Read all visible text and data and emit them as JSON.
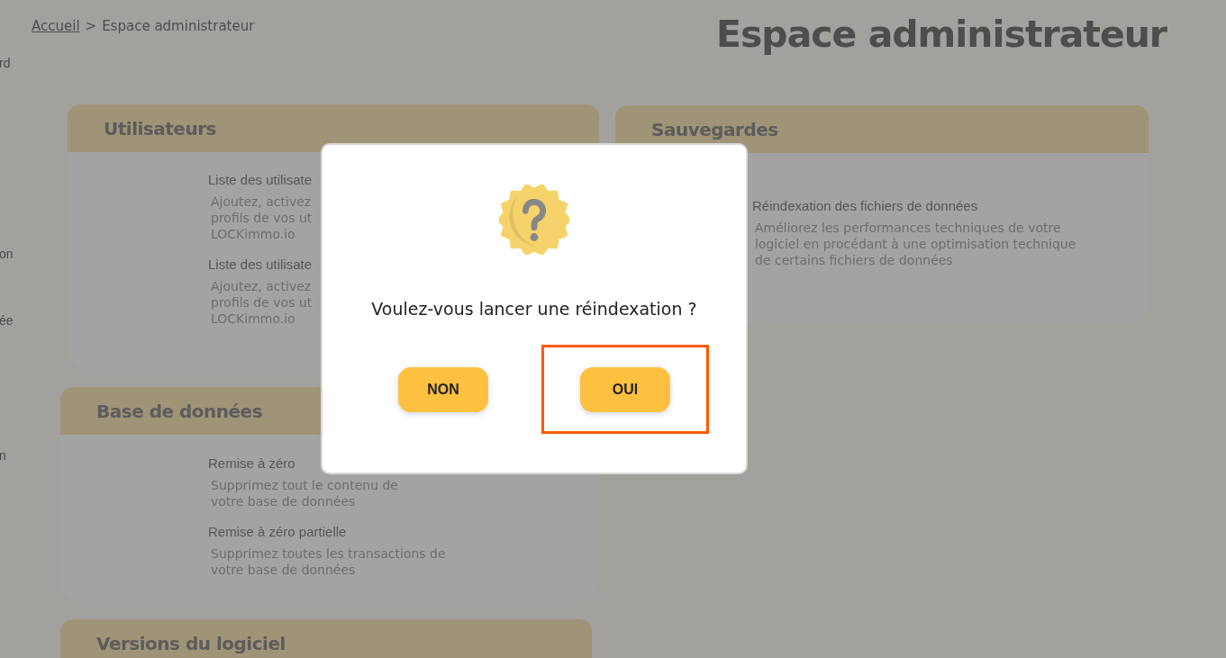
{
  "breadcrumb": {
    "link": "Accueil",
    "separator": ">",
    "current": "Espace administrateur"
  },
  "page_title": "Espace administrateur",
  "sidebar_fragments": [
    "rd",
    "on",
    "ée",
    "n"
  ],
  "left_cards": [
    {
      "title": "Utilisateurs",
      "items": [
        {
          "title": "Liste des utilisate",
          "description": [
            "Ajoutez, activez",
            "profils de vos ut",
            "LOCKimmo.io"
          ]
        },
        {
          "title": "Liste des utilisate",
          "description": [
            "Ajoutez, activez",
            "profils de vos ut",
            "LOCKimmo.io"
          ]
        }
      ]
    },
    {
      "title": "Base de données",
      "items": [
        {
          "title": "Remise à zéro",
          "description": [
            "Supprimez tout le contenu de",
            "votre base de données"
          ]
        },
        {
          "title": "Remise à zéro partielle",
          "description": [
            "Supprimez toutes les transactions de",
            "votre base de données"
          ]
        }
      ]
    },
    {
      "title": "Versions du logiciel"
    }
  ],
  "right_cards": [
    {
      "title": "Sauvegardes",
      "items": [
        {
          "title": "Réindexation des fichiers de données",
          "description": [
            "Améliorez les performances techniques de votre",
            "logiciel en procédant à une optimisation technique",
            "de certains fichiers de données"
          ]
        }
      ]
    }
  ],
  "dialog": {
    "message": "Voulez-vous lancer une réindexation ?",
    "buttons": [
      {
        "label": "NON",
        "highlighted": false
      },
      {
        "label": "OUI",
        "highlighted": true
      }
    ]
  }
}
